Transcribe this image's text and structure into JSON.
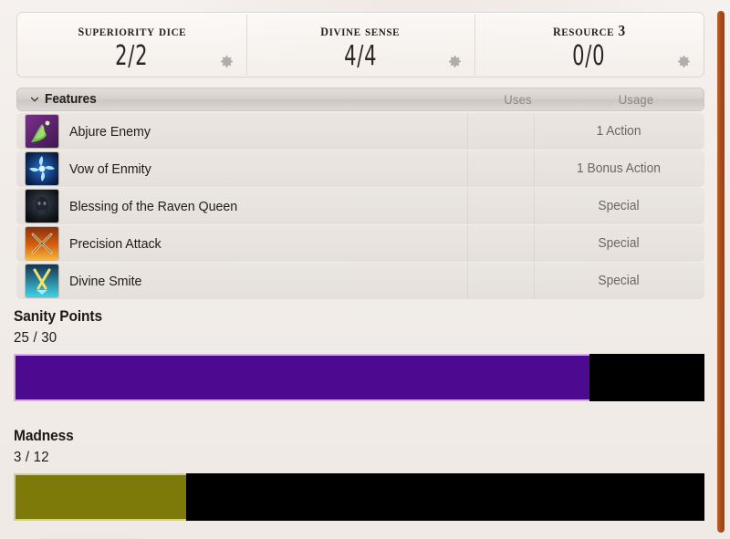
{
  "resources": [
    {
      "title": "Superiority Dice",
      "value": "2/2",
      "gear_icon": "gear-icon"
    },
    {
      "title": "Divine Sense",
      "value": "4/4",
      "gear_icon": "gear-icon"
    },
    {
      "title": "Resource 3",
      "value": "0/0",
      "gear_icon": "gear-icon"
    }
  ],
  "features": {
    "section_title": "Features",
    "collapse_icon": "chevron-down-icon",
    "columns": {
      "name": "",
      "uses": "Uses",
      "usage": "Usage"
    },
    "rows": [
      {
        "name": "Abjure Enemy",
        "uses": "",
        "usage": "1 Action",
        "icon": "abjure-enemy-icon"
      },
      {
        "name": "Vow of Enmity",
        "uses": "",
        "usage": "1 Bonus Action",
        "icon": "vow-of-enmity-icon"
      },
      {
        "name": "Blessing of the Raven Queen",
        "uses": "",
        "usage": "Special",
        "icon": "raven-queen-icon"
      },
      {
        "name": "Precision Attack",
        "uses": "",
        "usage": "Special",
        "icon": "precision-attack-icon"
      },
      {
        "name": "Divine Smite",
        "uses": "",
        "usage": "Special",
        "icon": "divine-smite-icon"
      }
    ]
  },
  "stats": [
    {
      "label": "Sanity Points",
      "value_text": "25 / 30",
      "current": 25,
      "max": 30,
      "percent": "83.33%",
      "fill_color": "#4b0a8f",
      "track_color": "#000000",
      "border_color": "#d9a8e8"
    },
    {
      "label": "Madness",
      "value_text": "3 / 12",
      "current": 3,
      "max": 12,
      "percent": "25%",
      "fill_color": "#7e7a0a",
      "track_color": "#000000",
      "border_color": "#d3cf8c"
    }
  ],
  "scrollbar": {
    "name": "vertical-scrollbar",
    "thumb_color": "#a8481a"
  }
}
